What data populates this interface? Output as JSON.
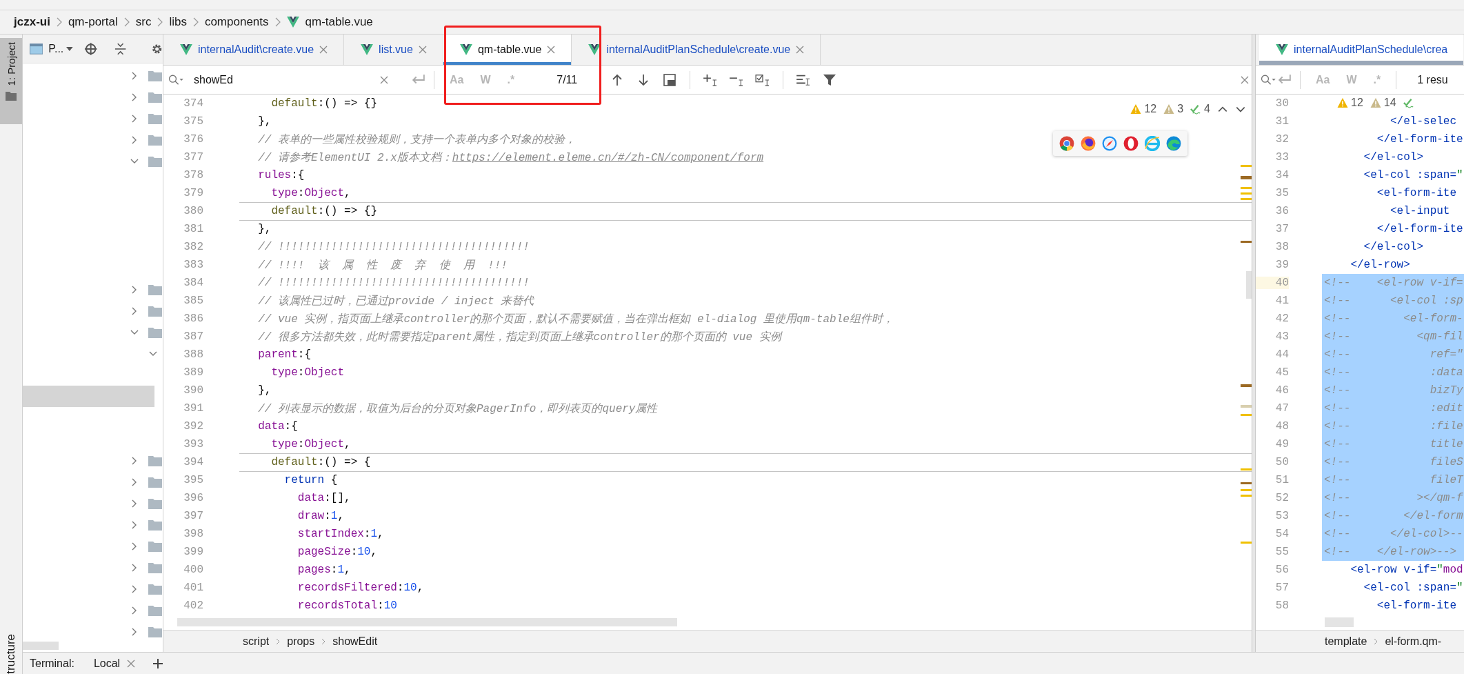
{
  "breadcrumb": [
    {
      "kind": "project",
      "label": "jczx-ui"
    },
    {
      "kind": "folder",
      "label": "qm-portal"
    },
    {
      "kind": "folder",
      "label": "src"
    },
    {
      "kind": "folder",
      "label": "libs"
    },
    {
      "kind": "folder",
      "label": "components"
    },
    {
      "kind": "vue_file",
      "label": "qm-table.vue"
    }
  ],
  "tool_strip": {
    "project_tab": {
      "label": "1: Project",
      "selected": true
    },
    "structure_tab": {
      "label": "tructure"
    }
  },
  "project_panel": {
    "title": "P...",
    "rows": [
      {
        "kind": "folder",
        "expanded": false,
        "selected": false
      },
      {
        "kind": "folder",
        "expanded": false,
        "selected": false
      },
      {
        "kind": "folder",
        "expanded": false,
        "selected": false
      },
      {
        "kind": "folder",
        "expanded": false,
        "selected": false
      },
      {
        "kind": "folder",
        "expanded": true,
        "selected": false
      },
      {
        "kind": "blank",
        "selected": false
      },
      {
        "kind": "blank",
        "selected": false
      },
      {
        "kind": "blank",
        "selected": false
      },
      {
        "kind": "blank",
        "selected": false
      },
      {
        "kind": "blank",
        "selected": false
      },
      {
        "kind": "folder",
        "expanded": false,
        "selected": false
      },
      {
        "kind": "folder",
        "expanded": false,
        "selected": false
      },
      {
        "kind": "folder",
        "expanded": true,
        "selected": false
      },
      {
        "kind": "subfolder",
        "expanded": true,
        "selected": false
      },
      {
        "kind": "blank",
        "selected": false
      },
      {
        "kind": "blank",
        "selected": true
      },
      {
        "kind": "blank",
        "selected": false
      },
      {
        "kind": "blank",
        "selected": false
      },
      {
        "kind": "folder",
        "expanded": false,
        "selected": false
      },
      {
        "kind": "folder",
        "expanded": false,
        "selected": false
      },
      {
        "kind": "folder",
        "expanded": false,
        "selected": false
      },
      {
        "kind": "folder",
        "expanded": false,
        "selected": false
      },
      {
        "kind": "folder",
        "expanded": false,
        "selected": false
      },
      {
        "kind": "folder",
        "expanded": false,
        "selected": false
      },
      {
        "kind": "folder",
        "expanded": false,
        "selected": false
      },
      {
        "kind": "folder",
        "expanded": false,
        "selected": false
      },
      {
        "kind": "folder",
        "expanded": false,
        "selected": false
      }
    ]
  },
  "editor": {
    "tabs": [
      {
        "label": "internalAudit\\create.vue",
        "selected": false
      },
      {
        "label": "list.vue",
        "selected": false
      },
      {
        "label": "qm-table.vue",
        "selected": true
      },
      {
        "label": "internalAuditPlanSchedule\\create.vue",
        "selected": false
      }
    ],
    "find": {
      "value": "showEd",
      "toggles": [
        {
          "label": "Aa",
          "selected": false
        },
        {
          "label": "W",
          "selected": false
        },
        {
          "label": ".*",
          "selected": false
        }
      ],
      "match_count": "7/11"
    },
    "inspections": [
      {
        "kind": "warning",
        "count": "12"
      },
      {
        "kind": "weak_warning",
        "count": "3"
      },
      {
        "kind": "typo",
        "count": "4"
      }
    ],
    "browsers": [
      {
        "kind": "chrome"
      },
      {
        "kind": "firefox"
      },
      {
        "kind": "safari"
      },
      {
        "kind": "opera"
      },
      {
        "kind": "ie"
      },
      {
        "kind": "edge"
      }
    ],
    "lines": [
      {
        "number": "374",
        "separator_above": false,
        "tokens": [
          {
            "kind": "fn",
            "text": "    default"
          },
          {
            "kind": "plain",
            "text": ":() => {}"
          }
        ]
      },
      {
        "number": "375",
        "separator_above": false,
        "tokens": [
          {
            "kind": "plain",
            "text": "  },"
          }
        ]
      },
      {
        "number": "376",
        "separator_above": false,
        "tokens": [
          {
            "kind": "comment",
            "text": "  // 表单的一些属性校验规则，支持一个表单内多个对象的校验，"
          }
        ]
      },
      {
        "number": "377",
        "separator_above": false,
        "tokens": [
          {
            "kind": "comment",
            "text": "  // 请参考ElementUI 2.x版本文档："
          },
          {
            "kind": "link",
            "text": "https://element.eleme.cn/#/zh-CN/component/form"
          }
        ]
      },
      {
        "number": "378",
        "separator_above": false,
        "tokens": [
          {
            "kind": "prop",
            "text": "  rules"
          },
          {
            "kind": "plain",
            "text": ":{"
          }
        ]
      },
      {
        "number": "379",
        "separator_above": false,
        "tokens": [
          {
            "kind": "prop",
            "text": "    type"
          },
          {
            "kind": "plain",
            "text": ":"
          },
          {
            "kind": "prop",
            "text": "Object"
          },
          {
            "kind": "plain",
            "text": ","
          }
        ]
      },
      {
        "number": "380",
        "separator_above": true,
        "tokens": [
          {
            "kind": "fn",
            "text": "    default"
          },
          {
            "kind": "plain",
            "text": ":() => {}"
          }
        ]
      },
      {
        "number": "381",
        "separator_above": true,
        "tokens": [
          {
            "kind": "plain",
            "text": "  },"
          }
        ]
      },
      {
        "number": "382",
        "separator_above": false,
        "tokens": [
          {
            "kind": "comment",
            "text": "  // !!!!!!!!!!!!!!!!!!!!!!!!!!!!!!!!!!!!!!"
          }
        ]
      },
      {
        "number": "383",
        "separator_above": false,
        "tokens": [
          {
            "kind": "comment",
            "text": "  // !!!!  该  属  性  废  弃  使  用  !!!"
          }
        ]
      },
      {
        "number": "384",
        "separator_above": false,
        "tokens": [
          {
            "kind": "comment",
            "text": "  // !!!!!!!!!!!!!!!!!!!!!!!!!!!!!!!!!!!!!!"
          }
        ]
      },
      {
        "number": "385",
        "separator_above": false,
        "tokens": [
          {
            "kind": "comment",
            "text": "  // 该属性已过时，已通过provide / inject 来替代"
          }
        ]
      },
      {
        "number": "386",
        "separator_above": false,
        "tokens": [
          {
            "kind": "comment",
            "text": "  // vue 实例，指页面上继承controller的那个页面，默认不需要赋值，当在弹出框如 el-dialog 里使用qm-table组件时，"
          }
        ]
      },
      {
        "number": "387",
        "separator_above": false,
        "tokens": [
          {
            "kind": "comment",
            "text": "  // 很多方法都失效，此时需要指定parent属性，指定到页面上继承controller的那个页面的 vue 实例"
          }
        ]
      },
      {
        "number": "388",
        "separator_above": false,
        "tokens": [
          {
            "kind": "prop",
            "text": "  parent"
          },
          {
            "kind": "plain",
            "text": ":{"
          }
        ]
      },
      {
        "number": "389",
        "separator_above": false,
        "tokens": [
          {
            "kind": "prop",
            "text": "    type"
          },
          {
            "kind": "plain",
            "text": ":"
          },
          {
            "kind": "prop",
            "text": "Object"
          }
        ]
      },
      {
        "number": "390",
        "separator_above": false,
        "tokens": [
          {
            "kind": "plain",
            "text": "  },"
          }
        ]
      },
      {
        "number": "391",
        "separator_above": false,
        "tokens": [
          {
            "kind": "comment",
            "text": "  // 列表显示的数据，取值为后台的分页对象PagerInfo，即列表页的query属性"
          }
        ]
      },
      {
        "number": "392",
        "separator_above": false,
        "tokens": [
          {
            "kind": "prop",
            "text": "  data"
          },
          {
            "kind": "plain",
            "text": ":{"
          }
        ]
      },
      {
        "number": "393",
        "separator_above": false,
        "tokens": [
          {
            "kind": "prop",
            "text": "    type"
          },
          {
            "kind": "plain",
            "text": ":"
          },
          {
            "kind": "prop",
            "text": "Object"
          },
          {
            "kind": "plain",
            "text": ","
          }
        ]
      },
      {
        "number": "394",
        "separator_above": true,
        "tokens": [
          {
            "kind": "fn",
            "text": "    default"
          },
          {
            "kind": "plain",
            "text": ":() => {"
          }
        ]
      },
      {
        "number": "395",
        "separator_above": true,
        "tokens": [
          {
            "kind": "keyword",
            "text": "      return"
          },
          {
            "kind": "plain",
            "text": " {"
          }
        ]
      },
      {
        "number": "396",
        "separator_above": false,
        "tokens": [
          {
            "kind": "prop",
            "text": "        data"
          },
          {
            "kind": "plain",
            "text": ":[],"
          }
        ]
      },
      {
        "number": "397",
        "separator_above": false,
        "tokens": [
          {
            "kind": "prop",
            "text": "        draw"
          },
          {
            "kind": "plain",
            "text": ":"
          },
          {
            "kind": "number",
            "text": "1"
          },
          {
            "kind": "plain",
            "text": ","
          }
        ]
      },
      {
        "number": "398",
        "separator_above": false,
        "tokens": [
          {
            "kind": "prop",
            "text": "        startIndex"
          },
          {
            "kind": "plain",
            "text": ":"
          },
          {
            "kind": "number",
            "text": "1"
          },
          {
            "kind": "plain",
            "text": ","
          }
        ]
      },
      {
        "number": "399",
        "separator_above": false,
        "tokens": [
          {
            "kind": "prop",
            "text": "        pageSize"
          },
          {
            "kind": "plain",
            "text": ":"
          },
          {
            "kind": "number",
            "text": "10"
          },
          {
            "kind": "plain",
            "text": ","
          }
        ]
      },
      {
        "number": "400",
        "separator_above": false,
        "tokens": [
          {
            "kind": "prop",
            "text": "        pages"
          },
          {
            "kind": "plain",
            "text": ":"
          },
          {
            "kind": "number",
            "text": "1"
          },
          {
            "kind": "plain",
            "text": ","
          }
        ]
      },
      {
        "number": "401",
        "separator_above": false,
        "tokens": [
          {
            "kind": "prop",
            "text": "        recordsFiltered"
          },
          {
            "kind": "plain",
            "text": ":"
          },
          {
            "kind": "number",
            "text": "10"
          },
          {
            "kind": "plain",
            "text": ","
          }
        ]
      },
      {
        "number": "402",
        "separator_above": false,
        "tokens": [
          {
            "kind": "prop",
            "text": "        recordsTotal"
          },
          {
            "kind": "plain",
            "text": ":"
          },
          {
            "kind": "number",
            "text": "10"
          }
        ]
      }
    ],
    "breadcrumb": [
      "script",
      "props",
      "showEdit"
    ]
  },
  "side_editor": {
    "tab": {
      "label": "internalAuditPlanSchedule\\crea",
      "selected": true
    },
    "find": {
      "toggles": [
        {
          "label": "Aa",
          "selected": false
        },
        {
          "label": "W",
          "selected": false
        },
        {
          "label": ".*",
          "selected": false
        }
      ],
      "result": "1 resu"
    },
    "inspections": [
      {
        "kind": "warning",
        "count": "12"
      },
      {
        "kind": "weak_warning",
        "count": "14"
      },
      {
        "kind": "typo"
      }
    ],
    "lines": [
      {
        "number": "30",
        "selected": false,
        "current": false
      },
      {
        "number": "31",
        "selected": false,
        "current": false,
        "tokens": [
          {
            "kind": "tag",
            "text": "          </el-selec"
          }
        ]
      },
      {
        "number": "32",
        "selected": false,
        "current": false,
        "tokens": [
          {
            "kind": "tag",
            "text": "        </el-form-ite"
          }
        ]
      },
      {
        "number": "33",
        "selected": false,
        "current": false,
        "tokens": [
          {
            "kind": "tag",
            "text": "      </el-col>"
          }
        ]
      },
      {
        "number": "34",
        "selected": false,
        "current": false,
        "tokens": [
          {
            "kind": "tag",
            "text": "      <el-col"
          },
          {
            "kind": "attr",
            "text": " :span="
          },
          {
            "kind": "string",
            "text": "\""
          }
        ]
      },
      {
        "number": "35",
        "selected": false,
        "current": false,
        "tokens": [
          {
            "kind": "tag",
            "text": "        <el-form-ite"
          }
        ]
      },
      {
        "number": "36",
        "selected": false,
        "current": false,
        "tokens": [
          {
            "kind": "tag",
            "text": "          <el-input"
          }
        ]
      },
      {
        "number": "37",
        "selected": false,
        "current": false,
        "tokens": [
          {
            "kind": "tag",
            "text": "        </el-form-ite"
          }
        ]
      },
      {
        "number": "38",
        "selected": false,
        "current": false,
        "tokens": [
          {
            "kind": "tag",
            "text": "      </el-col>"
          }
        ]
      },
      {
        "number": "39",
        "selected": false,
        "current": false,
        "tokens": [
          {
            "kind": "tag",
            "text": "    </el-row>"
          }
        ]
      },
      {
        "number": "40",
        "selected": true,
        "current": true,
        "tokens": [
          {
            "kind": "comment",
            "text": "<!--    <el-row v-if="
          }
        ]
      },
      {
        "number": "41",
        "selected": true,
        "current": false,
        "tokens": [
          {
            "kind": "comment",
            "text": "<!--      <el-col :sp"
          }
        ]
      },
      {
        "number": "42",
        "selected": true,
        "current": false,
        "tokens": [
          {
            "kind": "comment",
            "text": "<!--        <el-form-"
          }
        ]
      },
      {
        "number": "43",
        "selected": true,
        "current": false,
        "tokens": [
          {
            "kind": "comment",
            "text": "<!--          <qm-fil"
          }
        ]
      },
      {
        "number": "44",
        "selected": true,
        "current": false,
        "tokens": [
          {
            "kind": "comment",
            "text": "<!--            ref=\""
          }
        ]
      },
      {
        "number": "45",
        "selected": true,
        "current": false,
        "tokens": [
          {
            "kind": "comment",
            "text": "<!--            :data"
          }
        ]
      },
      {
        "number": "46",
        "selected": true,
        "current": false,
        "tokens": [
          {
            "kind": "comment",
            "text": "<!--            bizTy"
          }
        ]
      },
      {
        "number": "47",
        "selected": true,
        "current": false,
        "tokens": [
          {
            "kind": "comment",
            "text": "<!--            :edit"
          }
        ]
      },
      {
        "number": "48",
        "selected": true,
        "current": false,
        "tokens": [
          {
            "kind": "comment",
            "text": "<!--            :file"
          }
        ]
      },
      {
        "number": "49",
        "selected": true,
        "current": false,
        "tokens": [
          {
            "kind": "comment",
            "text": "<!--            title"
          }
        ]
      },
      {
        "number": "50",
        "selected": true,
        "current": false,
        "tokens": [
          {
            "kind": "comment",
            "text": "<!--            fileS"
          }
        ]
      },
      {
        "number": "51",
        "selected": true,
        "current": false,
        "tokens": [
          {
            "kind": "comment",
            "text": "<!--            fileT"
          }
        ]
      },
      {
        "number": "52",
        "selected": true,
        "current": false,
        "tokens": [
          {
            "kind": "comment",
            "text": "<!--          ></qm-f"
          }
        ]
      },
      {
        "number": "53",
        "selected": true,
        "current": false,
        "tokens": [
          {
            "kind": "comment",
            "text": "<!--        </el-form"
          }
        ]
      },
      {
        "number": "54",
        "selected": true,
        "current": false,
        "tokens": [
          {
            "kind": "comment",
            "text": "<!--      </el-col>--"
          }
        ]
      },
      {
        "number": "55",
        "selected": true,
        "current": false,
        "tokens": [
          {
            "kind": "comment",
            "text": "<!--    </el-row>-->"
          }
        ]
      },
      {
        "number": "56",
        "selected": false,
        "current": false,
        "tokens": [
          {
            "kind": "tag",
            "text": "    <el-row"
          },
          {
            "kind": "attr",
            "text": " v-if="
          },
          {
            "kind": "string",
            "text": "\""
          },
          {
            "kind": "prop",
            "text": "mod"
          }
        ]
      },
      {
        "number": "57",
        "selected": false,
        "current": false,
        "tokens": [
          {
            "kind": "tag",
            "text": "      <el-col"
          },
          {
            "kind": "attr",
            "text": " :span="
          },
          {
            "kind": "string",
            "text": "\""
          }
        ]
      },
      {
        "number": "58",
        "selected": false,
        "current": false,
        "tokens": [
          {
            "kind": "tag",
            "text": "        <el-form-ite"
          }
        ]
      }
    ],
    "breadcrumb": [
      "template",
      "el-form.qm-"
    ]
  },
  "bottom_bar": {
    "label": "Terminal:",
    "tabs": [
      {
        "label": "Local"
      }
    ]
  }
}
